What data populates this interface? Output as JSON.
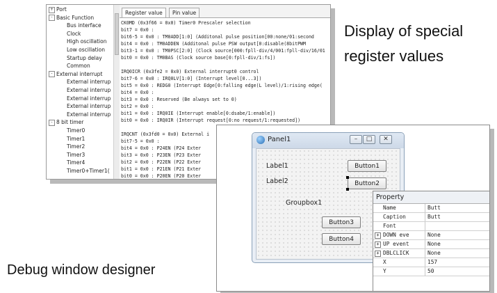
{
  "register_window": {
    "tree": [
      {
        "label": "Port",
        "indent": 0,
        "expander": "+"
      },
      {
        "label": "Basic Function",
        "indent": 0,
        "expander": "-"
      },
      {
        "label": "Bus interface",
        "indent": 2
      },
      {
        "label": "Clock",
        "indent": 2
      },
      {
        "label": "High oscillation",
        "indent": 2
      },
      {
        "label": "Low oscillation",
        "indent": 2
      },
      {
        "label": "Startup delay",
        "indent": 2
      },
      {
        "label": "Common",
        "indent": 2
      },
      {
        "label": "External interrupt",
        "indent": 0,
        "expander": "-"
      },
      {
        "label": "External interrup",
        "indent": 2
      },
      {
        "label": "External interrup",
        "indent": 2
      },
      {
        "label": "External interrup",
        "indent": 2
      },
      {
        "label": "External interrup",
        "indent": 2
      },
      {
        "label": "External interrup",
        "indent": 2
      },
      {
        "label": "8 bit timer",
        "indent": 0,
        "expander": "-"
      },
      {
        "label": "Timer0",
        "indent": 2
      },
      {
        "label": "Timer1",
        "indent": 2
      },
      {
        "label": "Timer2",
        "indent": 2
      },
      {
        "label": "Timer3",
        "indent": 2
      },
      {
        "label": "Timer4",
        "indent": 2
      },
      {
        "label": "Timer0+Timer1(",
        "indent": 2
      }
    ],
    "tabs": [
      "Register value",
      "Pin value"
    ],
    "lines": [
      "CK0MD (0x3f66 = 0x0) Timer0 Prescaler selection",
      "  bit7   = 0x0 :",
      "  bit6-5 = 0x0 : TM0ADD[1:0] (Additonal pulse position[00:none/01:second",
      "  bit4   = 0x0 : TM0ADDEN (Additonal pulse PSW output[0:disable(8bitPWM",
      "  bit3-1 = 0x0 : TM0PSC[2:0] (Clock source[000:fpll-div/4/001:fpll-div/16/01",
      "  bit0   = 0x0 : TM0BAS (Clock source base[0:fpll-div/1:fs])",
      "",
      "IRQ0ICR (0x3fe2 = 0x0) External interrupt0 control",
      "  bit7-6 = 0x0 : IRQ0LV[1:0] (Interrupt level[0...3])",
      "  bit5   = 0x0 : REDG0 (Interrupt Edge[0:falling edge(L level)/1:rising edge(",
      "  bit4   = 0x0 :",
      "  bit3   = 0x0 : Reserved (Be always set to 0)",
      "  bit2   = 0x0 :",
      "  bit1   = 0x0 : IRQ0IE (Interrupt enable[0:dsabe/1:enable])",
      "  bit0   = 0x0 : IRQ0IR (Interrupt request[0:no request/1:requested])",
      "",
      "IRQCNT (0x3fd0 = 0x0) External i",
      "  bit7-5 = 0x0 :",
      "  bit4   = 0x0 : P24EN (P24 Exter",
      "  bit3   = 0x0 : P23EN (P23 Exter",
      "  bit2   = 0x0 : P22EN (P22 Exter",
      "  bit1   = 0x0 : P21EN (P21 Exter",
      "  bit0   = 0x0 : P20EN (P20 Exter"
    ]
  },
  "captions": {
    "top_line1": "Display of special",
    "top_line2": "register values",
    "bottom": "Debug window designer"
  },
  "designer": {
    "panel_title": "Panel1",
    "caption_buttons": [
      "–",
      "□",
      "✕"
    ],
    "label1": "Label1",
    "label2": "Label2",
    "groupbox": "Groupbox1",
    "button1": "Button1",
    "button2": "Button2",
    "button3": "Button3",
    "button4": "Button4",
    "property_title": "Property",
    "properties": [
      {
        "key": "Name",
        "value": "Butt",
        "expander": ""
      },
      {
        "key": "Caption",
        "value": "Butt",
        "expander": ""
      },
      {
        "key": "Font",
        "value": "",
        "expander": ""
      },
      {
        "key": "DOWN eve",
        "value": "None",
        "expander": "+"
      },
      {
        "key": "UP event",
        "value": "None",
        "expander": "+"
      },
      {
        "key": "DBLCLICK",
        "value": "None",
        "expander": "+"
      },
      {
        "key": "X",
        "value": "157",
        "expander": ""
      },
      {
        "key": "Y",
        "value": "50",
        "expander": ""
      }
    ]
  }
}
